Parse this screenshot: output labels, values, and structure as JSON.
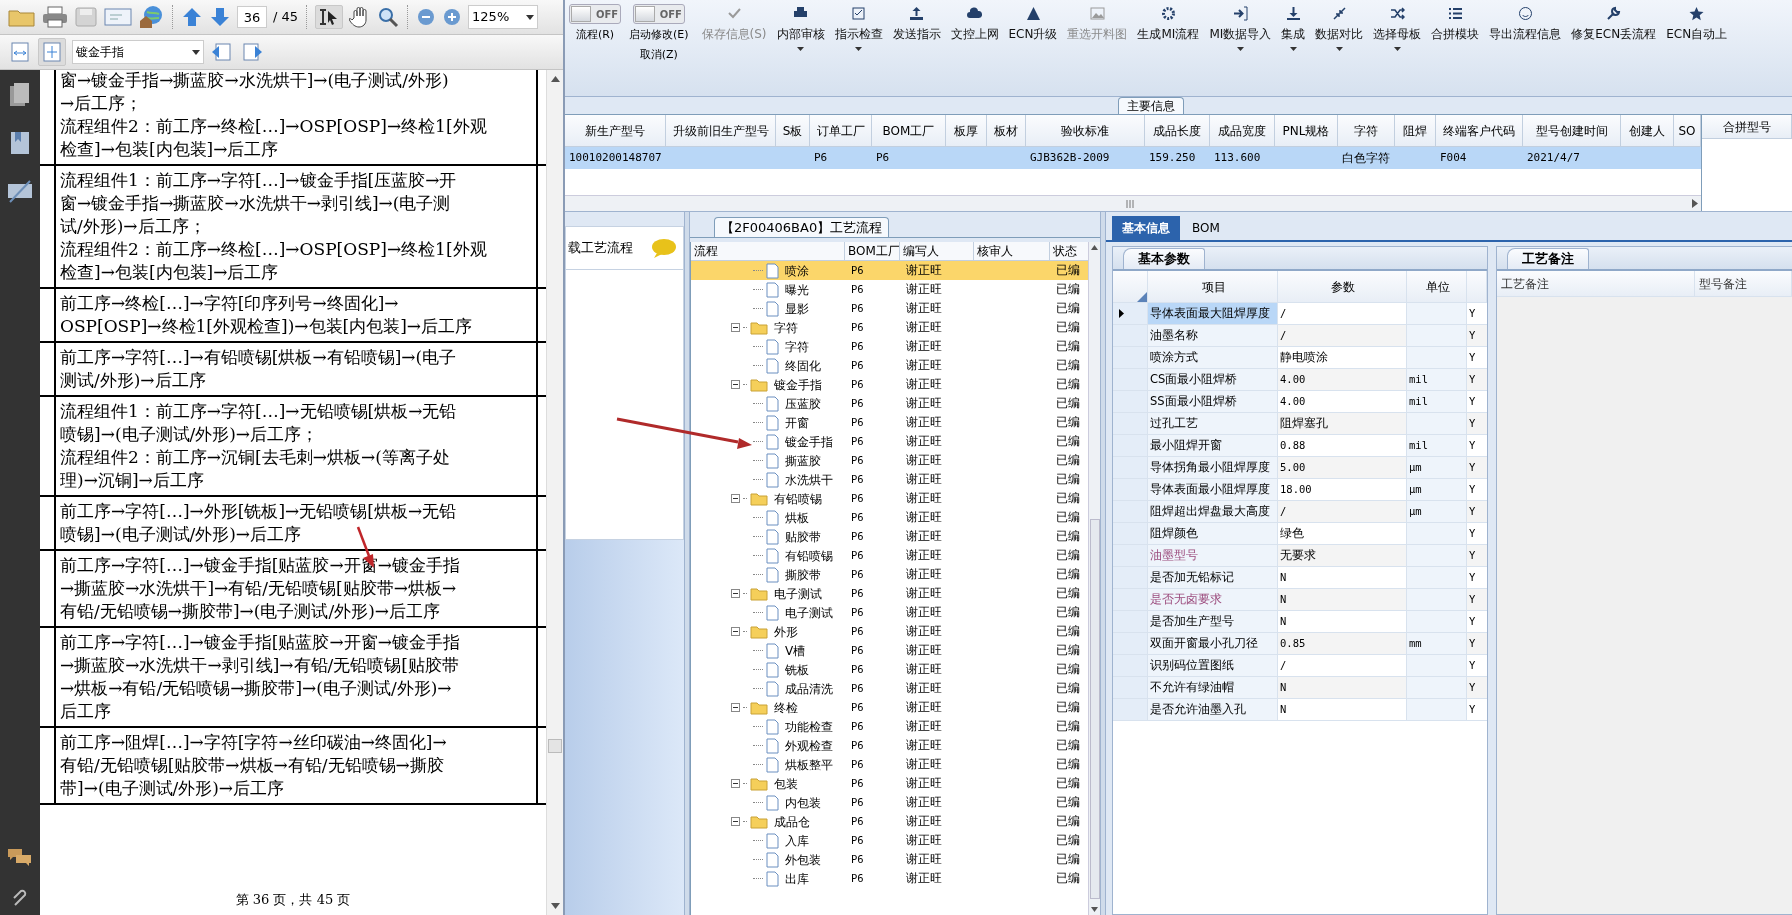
{
  "pdf_viewer": {
    "page_number": "36",
    "page_count": "/ 45",
    "zoom": "125%",
    "bookmark": "镀金手指",
    "rows": [
      {
        "lines": [
          "窗→镀金手指→撕蓝胶→水洗烘干]→(电子测试/外形)",
          "→后工序；",
          "流程组件2：前工序→终检[…]→OSP[OSP]→终检1[外观",
          "检查]→包装[内包装]→后工序"
        ]
      },
      {
        "lines": [
          "流程组件1：前工序→字符[…]→镀金手指[压蓝胶→开",
          "窗→镀金手指→撕蓝胶→水洗烘干→剥引线]→(电子测",
          "试/外形)→后工序；",
          "流程组件2：前工序→终检[…]→OSP[OSP]→终检1[外观",
          "检查]→包装[内包装]→后工序"
        ]
      },
      {
        "lines": [
          "前工序→终检[…]→字符[印序列号→终固化]→",
          "OSP[OSP]→终检1[外观检查])→包装[内包装]→后工序"
        ]
      },
      {
        "lines": [
          "前工序→字符[…]→有铅喷锡[烘板→有铅喷锡]→(电子",
          "测试/外形)→后工序"
        ]
      },
      {
        "lines": [
          "流程组件1：前工序→字符[…]→无铅喷锡[烘板→无铅",
          "喷锡]→(电子测试/外形)→后工序；",
          "流程组件2：前工序→沉铜[去毛刺→烘板→(等离子处",
          "理)→沉铜]→后工序"
        ]
      },
      {
        "lines": [
          "前工序→字符[…]→外形[铣板]→无铅喷锡[烘板→无铅",
          "喷锡]→(电子测试/外形)→后工序"
        ]
      },
      {
        "lines": [
          "前工序→字符[…]→镀金手指[贴蓝胶→开窗→镀金手指",
          "→撕蓝胶→水洗烘干]→有铅/无铅喷锡[贴胶带→烘板→",
          "有铅/无铅喷锡→撕胶带]→(电子测试/外形)→后工序"
        ]
      },
      {
        "lines": [
          "前工序→字符[…]→镀金手指[贴蓝胶→开窗→镀金手指",
          "→撕蓝胶→水洗烘干→剥引线]→有铅/无铅喷锡[贴胶带",
          "→烘板→有铅/无铅喷锡→撕胶带]→(电子测试/外形)→",
          "后工序"
        ]
      },
      {
        "lines": [
          "前工序→阻焊[…]→字符[字符→丝印碳油→终固化]→",
          "有铅/无铅喷锡[贴胶带→烘板→有铅/无铅喷锡→撕胶",
          "带]→(电子测试/外形)→后工序"
        ]
      }
    ],
    "footer": "第 36 页，共 45 页"
  },
  "toolbar": {
    "toggles": [
      {
        "label": "流程(R)",
        "switch_text": "OFF",
        "on": false
      },
      {
        "label": "启动修改(E)",
        "sub_label": "取消(Z)",
        "switch_text": "OFF",
        "on": false
      }
    ],
    "buttons": [
      {
        "label": "保存信息(S)",
        "disabled": true,
        "dropdown": false
      },
      {
        "label": "内部审核",
        "disabled": false,
        "dropdown": true
      },
      {
        "label": "指示检查",
        "disabled": false,
        "dropdown": true
      },
      {
        "label": "发送指示",
        "disabled": false,
        "dropdown": false
      },
      {
        "label": "文控上网",
        "disabled": false,
        "dropdown": false
      },
      {
        "label": "ECN升级",
        "disabled": false,
        "dropdown": false
      },
      {
        "label": "重选开料图",
        "disabled": true,
        "dropdown": false
      },
      {
        "label": "生成MI流程",
        "disabled": false,
        "dropdown": false
      },
      {
        "label": "MI数据导入",
        "disabled": false,
        "dropdown": true
      },
      {
        "label": "集成",
        "disabled": false,
        "dropdown": true
      },
      {
        "label": "数据对比",
        "disabled": false,
        "dropdown": true
      },
      {
        "label": "选择母板",
        "disabled": false,
        "dropdown": true
      },
      {
        "label": "合拼模块",
        "disabled": false,
        "dropdown": false
      },
      {
        "label": "导出流程信息",
        "disabled": false,
        "dropdown": false
      },
      {
        "label": "修复ECN丢流程",
        "disabled": false,
        "dropdown": false
      },
      {
        "label": "ECN自动上",
        "disabled": false,
        "dropdown": false
      }
    ]
  },
  "main_info": {
    "title": "主要信息",
    "columns": [
      "新生产型号",
      "升级前旧生产型号",
      "S板",
      "订单工厂",
      "BOM工厂",
      "板厚",
      "板材",
      "验收标准",
      "成品长度",
      "成品宽度",
      "PNL规格",
      "字符",
      "阻焊",
      "终端客户代码",
      "型号创建时间",
      "创建人",
      "SO"
    ],
    "rows": [
      {
        "selected": true,
        "cells": [
          "10010200148707",
          null,
          null,
          "P6",
          "P6",
          null,
          null,
          "GJB362B-2009",
          "159.250",
          "113.600",
          null,
          "白色字符",
          null,
          "F004",
          "2021/4/7",
          null,
          null
        ]
      }
    ],
    "side_column": "合拼型号"
  },
  "process_list": {
    "title": "载工艺流程"
  },
  "process_tree": {
    "title": "【2F00406BA0】工艺流程",
    "columns": [
      "流程",
      "BOM工厂",
      "编写人",
      "核审人",
      "状态"
    ],
    "items": [
      {
        "kind": "continued",
        "children": [
          {
            "kind": "step",
            "label": "喷涂",
            "factory": "P6",
            "writer": "谢正旺",
            "status": "已编",
            "selected": true
          },
          {
            "kind": "step",
            "label": "曝光",
            "factory": "P6",
            "writer": "谢正旺",
            "status": "已编",
            "selected": false
          },
          {
            "kind": "step",
            "label": "显影",
            "factory": "P6",
            "writer": "谢正旺",
            "status": "已编",
            "selected": false
          }
        ]
      },
      {
        "kind": "group",
        "label": "字符",
        "factory": "P6",
        "writer": "谢正旺",
        "status": "已编",
        "selected": false,
        "expanded": true,
        "children": [
          {
            "kind": "step",
            "label": "字符",
            "factory": "P6",
            "writer": "谢正旺",
            "status": "已编",
            "selected": false
          },
          {
            "kind": "step",
            "label": "终固化",
            "factory": "P6",
            "writer": "谢正旺",
            "status": "已编",
            "selected": false
          }
        ]
      },
      {
        "kind": "group",
        "label": "镀金手指",
        "factory": "P6",
        "writer": "谢正旺",
        "status": "已编",
        "selected": false,
        "expanded": true,
        "children": [
          {
            "kind": "step",
            "label": "压蓝胶",
            "factory": "P6",
            "writer": "谢正旺",
            "status": "已编",
            "selected": false
          },
          {
            "kind": "step",
            "label": "开窗",
            "factory": "P6",
            "writer": "谢正旺",
            "status": "已编",
            "selected": false
          },
          {
            "kind": "step",
            "label": "镀金手指",
            "factory": "P6",
            "writer": "谢正旺",
            "status": "已编",
            "selected": false
          },
          {
            "kind": "step",
            "label": "撕蓝胶",
            "factory": "P6",
            "writer": "谢正旺",
            "status": "已编",
            "selected": false
          },
          {
            "kind": "step",
            "label": "水洗烘干",
            "factory": "P6",
            "writer": "谢正旺",
            "status": "已编",
            "selected": false
          }
        ]
      },
      {
        "kind": "group",
        "label": "有铅喷锡",
        "factory": "P6",
        "writer": "谢正旺",
        "status": "已编",
        "selected": false,
        "expanded": true,
        "children": [
          {
            "kind": "step",
            "label": "烘板",
            "factory": "P6",
            "writer": "谢正旺",
            "status": "已编",
            "selected": false
          },
          {
            "kind": "step",
            "label": "贴胶带",
            "factory": "P6",
            "writer": "谢正旺",
            "status": "已编",
            "selected": false
          },
          {
            "kind": "step",
            "label": "有铅喷锡",
            "factory": "P6",
            "writer": "谢正旺",
            "status": "已编",
            "selected": false
          },
          {
            "kind": "step",
            "label": "撕胶带",
            "factory": "P6",
            "writer": "谢正旺",
            "status": "已编",
            "selected": false
          }
        ]
      },
      {
        "kind": "group",
        "label": "电子测试",
        "factory": "P6",
        "writer": "谢正旺",
        "status": "已编",
        "selected": false,
        "expanded": true,
        "children": [
          {
            "kind": "step",
            "label": "电子测试",
            "factory": "P6",
            "writer": "谢正旺",
            "status": "已编",
            "selected": false
          }
        ]
      },
      {
        "kind": "group",
        "label": "外形",
        "factory": "P6",
        "writer": "谢正旺",
        "status": "已编",
        "selected": false,
        "expanded": true,
        "children": [
          {
            "kind": "step",
            "label": "V槽",
            "factory": "P6",
            "writer": "谢正旺",
            "status": "已编",
            "selected": false
          },
          {
            "kind": "step",
            "label": "铣板",
            "factory": "P6",
            "writer": "谢正旺",
            "status": "已编",
            "selected": false
          },
          {
            "kind": "step",
            "label": "成品清洗",
            "factory": "P6",
            "writer": "谢正旺",
            "status": "已编",
            "selected": false
          }
        ]
      },
      {
        "kind": "group",
        "label": "终检",
        "factory": "P6",
        "writer": "谢正旺",
        "status": "已编",
        "selected": false,
        "expanded": true,
        "children": [
          {
            "kind": "step",
            "label": "功能检查",
            "factory": "P6",
            "writer": "谢正旺",
            "status": "已编",
            "selected": false
          },
          {
            "kind": "step",
            "label": "外观检查",
            "factory": "P6",
            "writer": "谢正旺",
            "status": "已编",
            "selected": false
          },
          {
            "kind": "step",
            "label": "烘板整平",
            "factory": "P6",
            "writer": "谢正旺",
            "status": "已编",
            "selected": false
          }
        ]
      },
      {
        "kind": "group",
        "label": "包装",
        "factory": "P6",
        "writer": "谢正旺",
        "status": "已编",
        "selected": false,
        "expanded": true,
        "children": [
          {
            "kind": "step",
            "label": "内包装",
            "factory": "P6",
            "writer": "谢正旺",
            "status": "已编",
            "selected": false
          }
        ]
      },
      {
        "kind": "group",
        "label": "成品仓",
        "factory": "P6",
        "writer": "谢正旺",
        "status": "已编",
        "selected": false,
        "expanded": true,
        "children": [
          {
            "kind": "step",
            "label": "入库",
            "factory": "P6",
            "writer": "谢正旺",
            "status": "已编",
            "selected": false
          },
          {
            "kind": "step",
            "label": "外包装",
            "factory": "P6",
            "writer": "谢正旺",
            "status": "已编",
            "selected": false
          },
          {
            "kind": "step",
            "label": "出库",
            "factory": "P6",
            "writer": "谢正旺",
            "status": "已编",
            "selected": false
          }
        ]
      }
    ]
  },
  "detail": {
    "tabs": [
      {
        "label": "基本信息",
        "selected": true
      },
      {
        "label": "BOM",
        "selected": false
      }
    ],
    "params": {
      "title": "基本参数",
      "columns": [
        "项目",
        "参数",
        "单位"
      ],
      "rows": [
        {
          "item": "导体表面最大阻焊厚度",
          "value": "/",
          "flag": "Y",
          "selected": true,
          "flagged": false
        },
        {
          "item": "油墨名称",
          "value": "/",
          "flag": "Y",
          "selected": false,
          "flagged": false
        },
        {
          "item": "喷涂方式",
          "value": "静电喷涂",
          "flag": "Y",
          "selected": false,
          "flagged": false
        },
        {
          "item": "CS面最小阻焊桥",
          "value": "4.00",
          "unit": "mil",
          "flag": "Y",
          "selected": false,
          "flagged": false
        },
        {
          "item": "SS面最小阻焊桥",
          "value": "4.00",
          "unit": "mil",
          "flag": "Y",
          "selected": false,
          "flagged": false
        },
        {
          "item": "过孔工艺",
          "value": "阻焊塞孔",
          "flag": "Y",
          "selected": false,
          "flagged": false
        },
        {
          "item": "最小阻焊开窗",
          "value": "0.88",
          "unit": "mil",
          "flag": "Y",
          "selected": false,
          "flagged": false
        },
        {
          "item": "导体拐角最小阻焊厚度",
          "value": "5.00",
          "unit": "μm",
          "flag": "Y",
          "selected": false,
          "flagged": false
        },
        {
          "item": "导体表面最小阻焊厚度",
          "value": "18.00",
          "unit": "μm",
          "flag": "Y",
          "selected": false,
          "flagged": false
        },
        {
          "item": "阻焊超出焊盘最大高度",
          "value": "/",
          "unit": "μm",
          "flag": "Y",
          "selected": false,
          "flagged": false
        },
        {
          "item": "阻焊颜色",
          "value": "绿色",
          "flag": "Y",
          "selected": false,
          "flagged": false
        },
        {
          "item": "油墨型号",
          "value": "无要求",
          "flag": "Y",
          "selected": false,
          "flagged": true
        },
        {
          "item": "是否加无铅标记",
          "value": "N",
          "flag": "Y",
          "selected": false,
          "flagged": false
        },
        {
          "item": "是否无卤要求",
          "value": "N",
          "flag": "Y",
          "selected": false,
          "flagged": true
        },
        {
          "item": "是否加生产型号",
          "value": "N",
          "flag": "Y",
          "selected": false,
          "flagged": false
        },
        {
          "item": "双面开窗最小孔刀径",
          "value": "0.85",
          "unit": "mm",
          "flag": "Y",
          "selected": false,
          "flagged": false
        },
        {
          "item": "识别码位置图纸",
          "value": "/",
          "flag": "Y",
          "selected": false,
          "flagged": false
        },
        {
          "item": "不允许有绿油帽",
          "value": "N",
          "flag": "Y",
          "selected": false,
          "flagged": false
        },
        {
          "item": "是否允许油墨入孔",
          "value": "N",
          "flag": "Y",
          "selected": false,
          "flagged": false
        }
      ]
    },
    "remarks": {
      "title": "工艺备注",
      "columns": [
        "工艺备注",
        "型号备注"
      ]
    }
  }
}
